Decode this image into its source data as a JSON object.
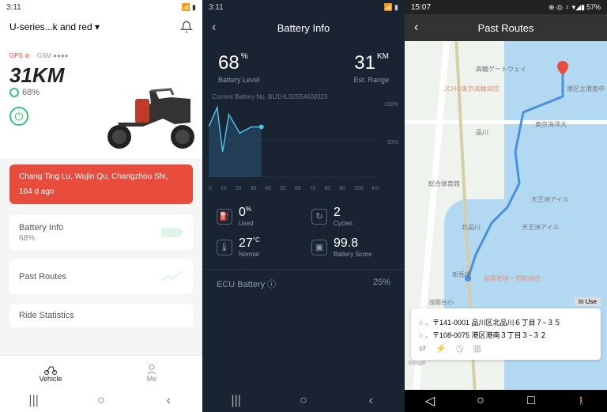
{
  "phone1": {
    "time": "3:11",
    "signal_icons": "📶",
    "header": {
      "title": "U-series...k and red ▾"
    },
    "gps_label": "GPS ⊘",
    "gsm_label": "GSM ●●●●",
    "range": "31KM",
    "battery_pct": "68%",
    "alert": {
      "location": "Chang Ting Lu, Wujin Qu, Changzhou Shi,",
      "ago": "164 d ago"
    },
    "cards": {
      "battery": {
        "title": "Battery Info",
        "sub": "68%"
      },
      "routes": {
        "title": "Past Routes"
      },
      "stats": {
        "title": "Ride Statistics"
      }
    },
    "nav": {
      "vehicle": "Vehicle",
      "me": "Me"
    }
  },
  "phone2": {
    "time": "3:11",
    "title": "Battery Info",
    "level": {
      "val": "68",
      "unit": "%",
      "label": "Battery Level"
    },
    "range": {
      "val": "31",
      "unit": "KM",
      "label": "Est. Range"
    },
    "battery_no": "Current Battery No. BU1HLS2554600323",
    "metrics": {
      "used": {
        "val": "0",
        "unit": "%",
        "label": "Used"
      },
      "cycles": {
        "val": "2",
        "label": "Cycles"
      },
      "temp": {
        "val": "27",
        "unit": "°C",
        "label": "Normal"
      },
      "score": {
        "val": "99.8",
        "label": "Battery Score"
      }
    },
    "ecu": {
      "label": "ECU Battery ⓘ",
      "val": "25%"
    }
  },
  "phone3": {
    "time": "15:07",
    "battery": "57%",
    "title": "Past Routes",
    "badge": "In Use",
    "start_addr": "〒141-0001 品川区北品川６丁目７−３５",
    "end_addr": "〒108-0075 港区港南３丁目３−３２",
    "map_labels": {
      "takanawa": "高輪ゲートウェイ",
      "jcho": "JCHO東京高輪病院",
      "minato": "港区立港南中",
      "shinagawa": "品川",
      "kaiyou": "東京海洋大",
      "gym": "総合体育館",
      "tennozu": "天王洲アイル",
      "tennozu2": "天王洲アイル",
      "kitashinagawa": "北品川",
      "shinbanba": "新馬場",
      "hospital": "稲葉脊椎・関節病院",
      "asamadai": "浅間台小"
    }
  },
  "chart_data": {
    "type": "line",
    "title": "",
    "xlabel": "km",
    "ylabel": "%",
    "x_ticks": [
      0,
      10,
      20,
      30,
      40,
      50,
      60,
      70,
      80,
      90,
      100
    ],
    "y_ticks": [
      50,
      100
    ],
    "ylim": [
      0,
      100
    ],
    "x": [
      0,
      5,
      8,
      12,
      18,
      25,
      31
    ],
    "values": [
      68,
      95,
      35,
      85,
      60,
      68,
      68
    ]
  }
}
